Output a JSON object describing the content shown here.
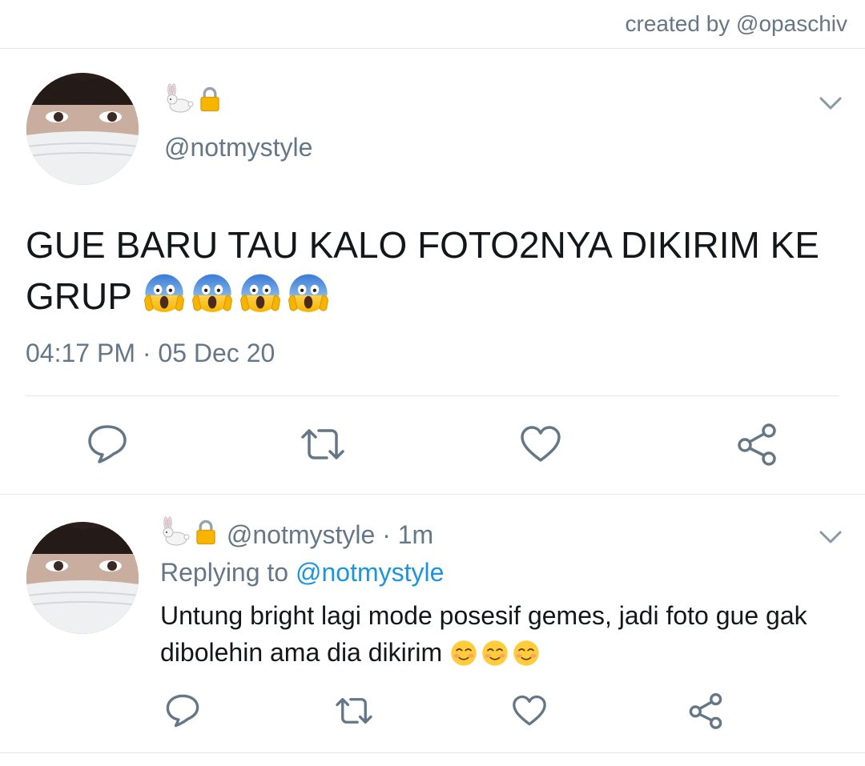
{
  "credit": "created by @opaschiv",
  "tweet": {
    "display_name_emoji": "rabbit + lock",
    "handle": "@notmystyle",
    "text": "GUE BARU TAU KALO FOTO2NYA DIKIRIM KE GRUP",
    "text_emoji": "face-screaming-in-fear x4",
    "time": "04:17 PM",
    "date": "05 Dec 20",
    "dot": "·"
  },
  "reply": {
    "display_name_emoji": "rabbit + lock",
    "handle": "@notmystyle",
    "age": "1m",
    "dot": "·",
    "replying_label": "Replying to",
    "replying_handle": "@notmystyle",
    "text": "Untung bright lagi mode posesif gemes, jadi foto gue gak dibolehin ama dia dikirim",
    "text_emoji": "smiling-face x3"
  },
  "icons": {
    "reply": "reply-icon",
    "retweet": "retweet-icon",
    "like": "heart-icon",
    "share": "share-icon",
    "menu": "chevron-down-icon"
  },
  "colors": {
    "text": "#14171a",
    "secondary": "#657786",
    "link": "#1b95e0",
    "divider": "#e1e8ed"
  }
}
